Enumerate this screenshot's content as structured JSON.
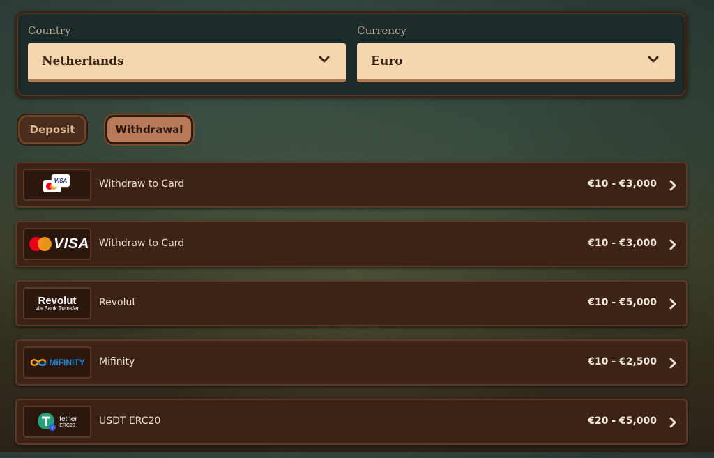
{
  "country": {
    "label": "Country",
    "value": "Netherlands"
  },
  "currency": {
    "label": "Currency",
    "value": "Euro"
  },
  "tabs": {
    "deposit": "Deposit",
    "withdrawal": "Withdrawal",
    "active": "withdrawal"
  },
  "methods": [
    {
      "logo": "card-icon",
      "name": "Withdraw to Card",
      "limits": "€10 - €3,000"
    },
    {
      "logo": "mastercard-visa-logo",
      "logo_text": "VISA",
      "name": "Withdraw to Card",
      "limits": "€10 - €3,000"
    },
    {
      "logo": "revolut-logo",
      "logo_title": "Revolut",
      "logo_sub": "via Bank Transfer",
      "name": "Revolut",
      "limits": "€10 - €5,000"
    },
    {
      "logo": "mifinity-logo",
      "logo_text": "MiFINITY",
      "name": "Mifinity",
      "limits": "€10 - €2,500"
    },
    {
      "logo": "tether-logo",
      "logo_title": "tether",
      "logo_sub": "ERC20",
      "name": "USDT ERC20",
      "limits": "€20 - €5,000"
    }
  ],
  "colors": {
    "accent": "#f6d7b0",
    "panel": "#1c2a29",
    "row": "#3c2316",
    "active_tab": "#b87a58"
  }
}
